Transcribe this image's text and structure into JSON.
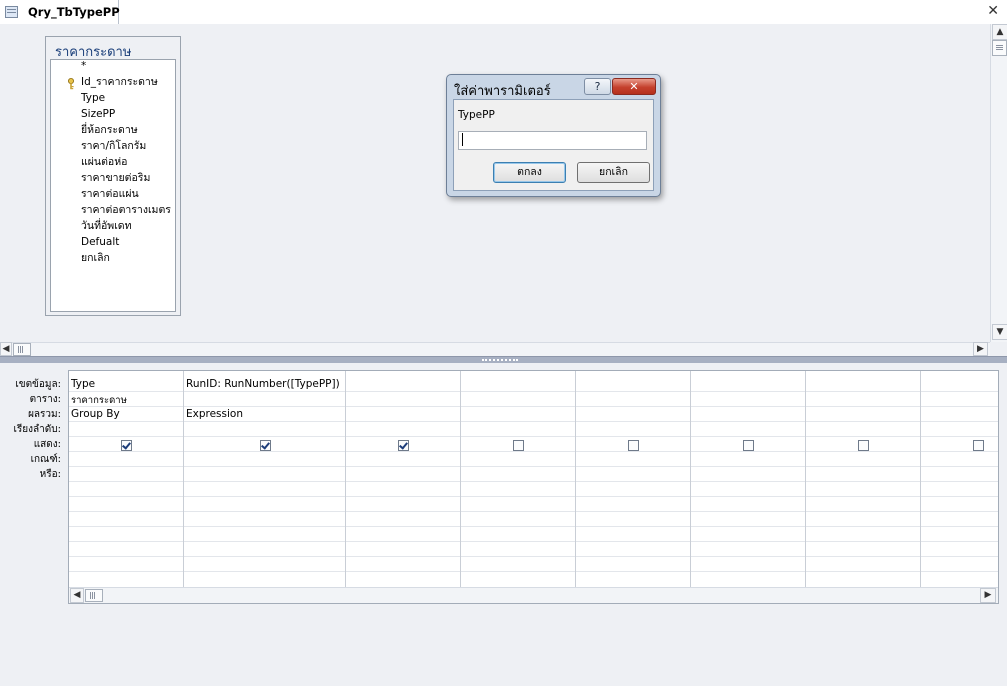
{
  "document_tab": {
    "title": "Qry_TbTypePP",
    "close_glyph": "✕"
  },
  "table_box": {
    "title": "ราคากระดาษ",
    "fields": [
      "*",
      "Id_ราคากระดาษ",
      "Type",
      "SizePP",
      "ยี่ห้อกระดาษ",
      "ราคา/กิโลกรัม",
      "แผ่นต่อห่อ",
      "ราคาขายต่อริม",
      "ราคาต่อแผ่น",
      "ราคาต่อตารางเมตร",
      "วันที่อัพเดท",
      "Defualt",
      "ยกเลิก"
    ],
    "primary_key_field": "Id_ราคากระดาษ"
  },
  "design_grid": {
    "row_labels": [
      "เขตข้อมูล:",
      "ตาราง:",
      "ผลรวม:",
      "เรียงลำดับ:",
      "แสดง:",
      "เกณฑ์:",
      "หรือ:"
    ],
    "columns": [
      {
        "field": "Type",
        "table": "ราคากระดาษ",
        "total": "Group By",
        "show": true
      },
      {
        "field": "RunID: RunNumber([TypePP])",
        "table": "",
        "total": "Expression",
        "show": true
      },
      {
        "field": "",
        "table": "",
        "total": "",
        "show": true
      },
      {
        "field": "",
        "table": "",
        "total": "",
        "show": false
      },
      {
        "field": "",
        "table": "",
        "total": "",
        "show": false
      },
      {
        "field": "",
        "table": "",
        "total": "",
        "show": false
      },
      {
        "field": "",
        "table": "",
        "total": "",
        "show": false
      },
      {
        "field": "",
        "table": "",
        "total": "",
        "show": false
      }
    ]
  },
  "dialog": {
    "title": "ใส่ค่าพารามิเตอร์",
    "help_glyph": "?",
    "close_glyph": "✕",
    "prompt": "TypePP",
    "input_value": "",
    "ok_label": "ตกลง",
    "cancel_label": "ยกเลิก"
  },
  "scroll": {
    "up": "▲",
    "down": "▼",
    "left": "◀",
    "right": "▶"
  },
  "colors": {
    "background": "#eef0f4",
    "splitter": "#a7b0c2",
    "table_title": "#1b3f7a",
    "dialog_frame": "#c9d6e6",
    "close_button": "#c5412d"
  }
}
